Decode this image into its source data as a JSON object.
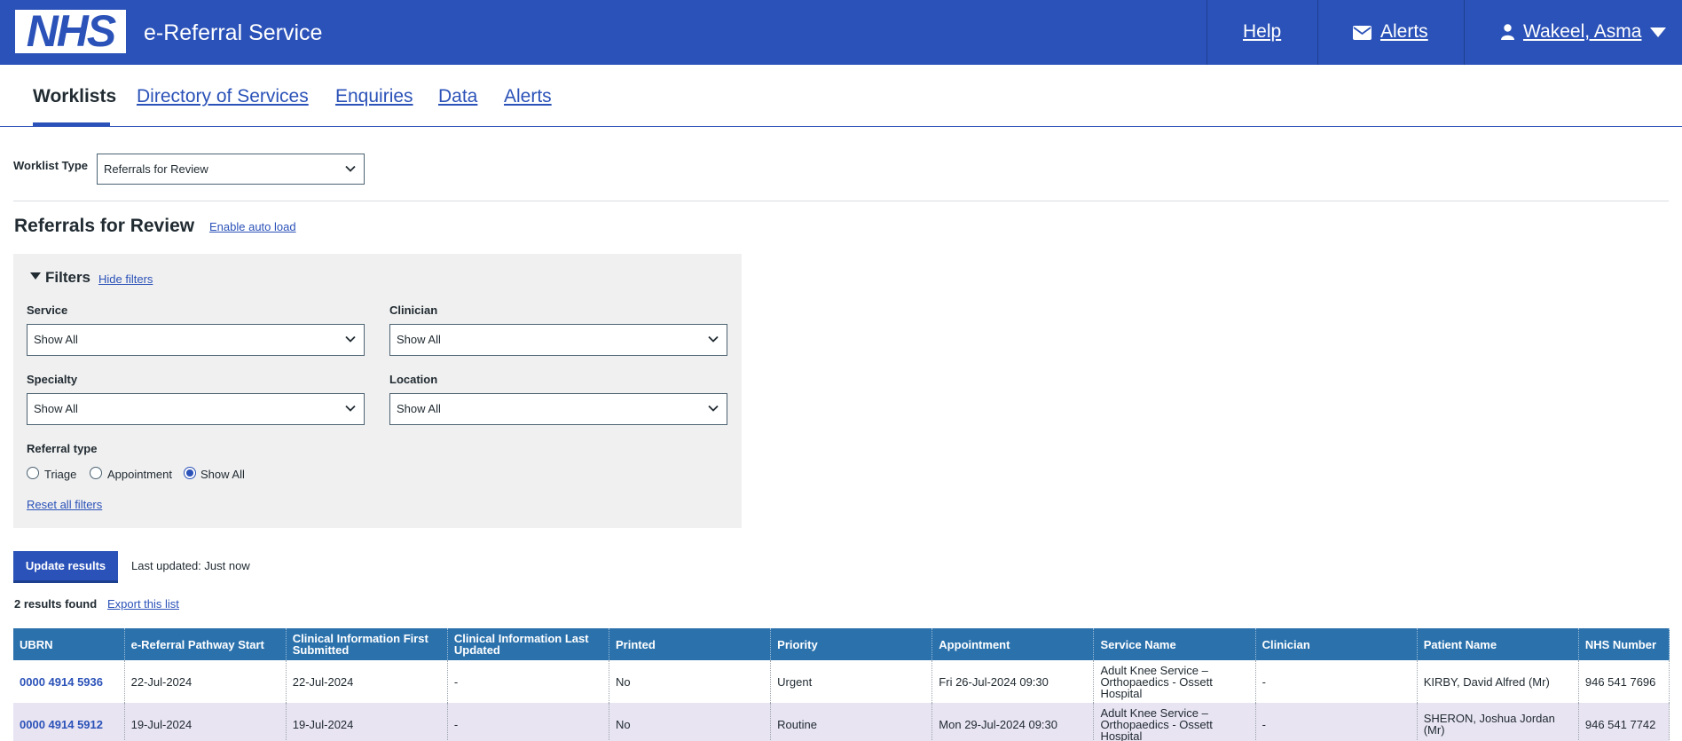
{
  "header": {
    "logo": "NHS",
    "service_name": "e-Referral Service",
    "help_label": "Help",
    "alerts_label": "Alerts",
    "user_label": "Wakeel, Asma"
  },
  "nav": {
    "tabs": [
      {
        "label": "Worklists",
        "active": true
      },
      {
        "label": "Directory of Services"
      },
      {
        "label": "Enquiries"
      },
      {
        "label": "Data"
      },
      {
        "label": "Alerts"
      }
    ]
  },
  "worklist_type": {
    "label": "Worklist Type",
    "selected": "Referrals for Review"
  },
  "page": {
    "title": "Referrals for Review",
    "auto_load_link": "Enable auto load"
  },
  "filters": {
    "title": "Filters",
    "hide_link": "Hide filters",
    "service": {
      "label": "Service",
      "selected": "Show All"
    },
    "clinician": {
      "label": "Clinician",
      "selected": "Show All"
    },
    "specialty": {
      "label": "Specialty",
      "selected": "Show All"
    },
    "location": {
      "label": "Location",
      "selected": "Show All"
    },
    "referral_type": {
      "label": "Referral type",
      "options": [
        "Triage",
        "Appointment",
        "Show All"
      ],
      "selected": "Show All"
    },
    "reset_link": "Reset all filters"
  },
  "actions": {
    "update_label": "Update results",
    "last_updated": "Last updated: Just now",
    "results_count": "2 results found",
    "export_link": "Export this list"
  },
  "table": {
    "headers": [
      "UBRN",
      "e-Referral Pathway Start",
      "Clinical Information First Submitted",
      "Clinical Information Last Updated",
      "Printed",
      "Priority",
      "Appointment",
      "Service Name",
      "Clinician",
      "Patient Name",
      "NHS Number"
    ],
    "rows": [
      [
        "0000 4914 5936",
        "22-Jul-2024",
        "22-Jul-2024",
        "-",
        "No",
        "Urgent",
        "Fri 26-Jul-2024 09:30",
        "Adult Knee Service – Orthopaedics - Ossett Hospital",
        "-",
        "KIRBY, David Alfred (Mr)",
        "946 541 7696"
      ],
      [
        "0000 4914 5912",
        "19-Jul-2024",
        "19-Jul-2024",
        "-",
        "No",
        "Routine",
        "Mon 29-Jul-2024 09:30",
        "Adult Knee Service – Orthopaedics - Ossett Hospital",
        "-",
        "SHERON, Joshua Jordan (Mr)",
        "946 541 7742"
      ]
    ]
  },
  "colors": {
    "nhs_blue": "#2b52b8",
    "table_header": "#2b72ad",
    "row_alt": "#e8e4f2",
    "panel_bg": "#f0f0f0"
  }
}
